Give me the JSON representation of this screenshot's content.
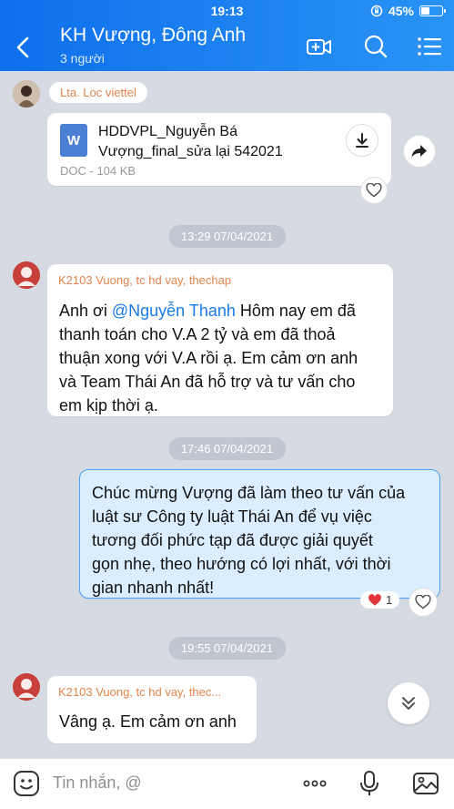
{
  "status": {
    "time": "19:13",
    "battery": "45%",
    "battery_level": 0.45
  },
  "header": {
    "title": "KH Vượng, Đông Anh",
    "subtitle": "3 người"
  },
  "messages": {
    "file_msg": {
      "sender": "Lta. Loc viettel",
      "file_icon_letter": "W",
      "file_name_line1": "HDDVPL_Nguyễn Bá",
      "file_name_line2": "Vượng_final_sửa lại 542021",
      "file_meta": "DOC - 104 KB"
    },
    "time1": "13:29 07/04/2021",
    "msg2": {
      "sender": "K2103 Vuong, tc hd vay, thechap",
      "line1_pre": "Anh ơi ",
      "mention": "@Nguyễn Thanh",
      "line1_post": " Hôm nay em đã",
      "line2": "thanh toán cho V.A 2 tỷ và em đã thoả",
      "line3": "thuận xong với V.A rồi ạ. Em cảm ơn anh",
      "line4": "và Team Thái An đã hỗ trợ và tư vấn cho",
      "line5": "em kịp thời ạ."
    },
    "time2": "17:46 07/04/2021",
    "msg3": {
      "line1": "Chúc mừng Vượng đã làm theo tư vấn của",
      "line2": "luật sư Công ty luật Thái An để vụ việc",
      "line3": "tương đối phức tạp đã được giải quyết",
      "line4": "gọn nhẹ, theo hướng có lợi nhất, với thời",
      "line5": "gian nhanh nhất!",
      "reaction_count": "1"
    },
    "time3": "19:55 07/04/2021",
    "msg4": {
      "sender": "K2103 Vuong, tc hd vay, thec...",
      "text": "Vâng ạ. Em cảm ơn anh"
    }
  },
  "composer": {
    "placeholder": "Tin nhắn, @"
  }
}
